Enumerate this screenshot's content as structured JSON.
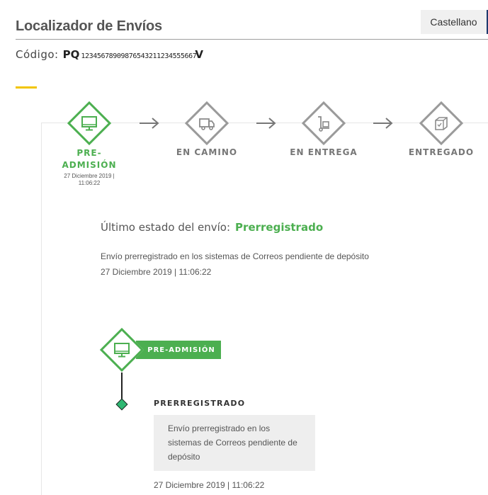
{
  "header": {
    "title": "Localizador de Envíos",
    "language_button": "Castellano"
  },
  "code": {
    "label": "Código:",
    "prefix": "PQ",
    "number": "12345678909876543211234555667",
    "suffix": "V"
  },
  "steps": [
    {
      "line1": "PRE-",
      "line2": "ADMISIÓN",
      "date_line1": "27 Diciembre 2019 |",
      "date_line2": "11:06:22",
      "active": true,
      "icon": "monitor-icon"
    },
    {
      "label": "EN CAMINO",
      "active": false,
      "icon": "truck-icon"
    },
    {
      "label": "EN ENTREGA",
      "active": false,
      "icon": "hand-truck-icon"
    },
    {
      "label": "ENTREGADO",
      "active": false,
      "icon": "package-check-icon"
    }
  ],
  "status": {
    "label": "Último estado del envío:",
    "value": "Prerregistrado",
    "description": "Envío prerregistrado en los sistemas de Correos pendiente de depósito",
    "date": "27 Diciembre 2019 | 11:06:22"
  },
  "timeline": {
    "stage_label": "PRE-ADMISIÓN",
    "event_title": "PRERREGISTRADO",
    "event_description": "Envío prerregistrado en los sistemas de Correos pendiente de depósito",
    "event_date": "27 Diciembre 2019 | 11:06:22"
  },
  "colors": {
    "accent_green": "#4caf50",
    "dot_green": "#2eb872",
    "highlight_yellow": "#f2c500",
    "inactive_gray": "#9a9a9a"
  }
}
